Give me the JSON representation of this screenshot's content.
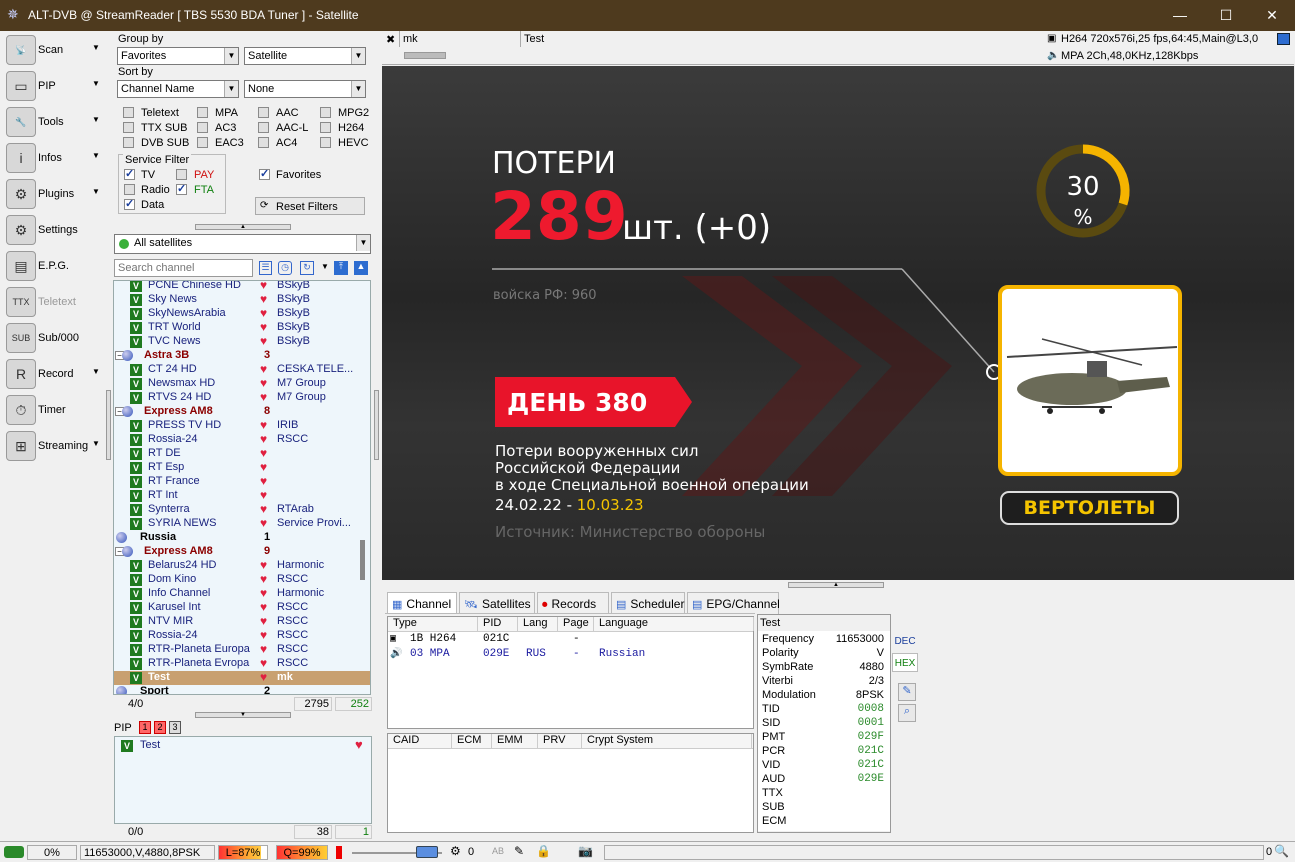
{
  "window": {
    "title": "ALT-DVB @ StreamReader [ TBS 5530 BDA Tuner ] - Satellite",
    "minimize": "—",
    "maximize": "☐",
    "close": "✕"
  },
  "sidebar": {
    "items": [
      {
        "label": "Scan",
        "icon": "satellite-dish-icon",
        "glyph": "📡",
        "arrow": "▼"
      },
      {
        "label": "PIP",
        "icon": "pip-icon",
        "glyph": "▭",
        "arrow": "▼"
      },
      {
        "label": "Tools",
        "icon": "tools-icon",
        "glyph": "🔧",
        "arrow": "▼"
      },
      {
        "label": "Infos",
        "icon": "info-icon",
        "glyph": "i",
        "arrow": "▼"
      },
      {
        "label": "Plugins",
        "icon": "plugins-icon",
        "glyph": "⚙",
        "arrow": "▼"
      },
      {
        "label": "Settings",
        "icon": "settings-icon",
        "glyph": "⚙",
        "arrow": ""
      },
      {
        "label": "E.P.G.",
        "icon": "epg-icon",
        "glyph": "▤",
        "arrow": ""
      },
      {
        "label": "Teletext",
        "icon": "teletext-icon",
        "glyph": "TTX",
        "arrow": ""
      },
      {
        "label": "Sub/000",
        "icon": "subtitle-icon",
        "glyph": "SUB",
        "arrow": ""
      },
      {
        "label": "Record",
        "icon": "record-icon",
        "glyph": "R",
        "arrow": "▼"
      },
      {
        "label": "Timer",
        "icon": "timer-icon",
        "glyph": "⏱",
        "arrow": ""
      },
      {
        "label": "Streaming",
        "icon": "streaming-icon",
        "glyph": "⊞",
        "arrow": "▼"
      }
    ]
  },
  "filters": {
    "group_by_label": "Group by",
    "group_by_1": "Favorites",
    "group_by_2": "Satellite",
    "sort_by_label": "Sort by",
    "sort_by_1": "Channel Name",
    "sort_by_2": "None",
    "stream_checks": [
      "Teletext",
      "MPA",
      "AAC",
      "MPG2",
      "TTX SUB",
      "AC3",
      "AAC-L",
      "H264",
      "DVB SUB",
      "EAC3",
      "AC4",
      "HEVC"
    ],
    "service_filter_label": "Service Filter",
    "tv": "TV",
    "pay": "PAY",
    "radio": "Radio",
    "fta": "FTA",
    "data": "Data",
    "favorites": "Favorites",
    "reset": "Reset Filters",
    "satellite_select": "All satellites",
    "search_placeholder": "Search channel"
  },
  "channels": [
    {
      "type": "ch",
      "name": "PCNE Chinese HD",
      "prov": "BSkyB"
    },
    {
      "type": "ch",
      "name": "Sky News",
      "prov": "BSkyB"
    },
    {
      "type": "ch",
      "name": "SkyNewsArabia",
      "prov": "BSkyB"
    },
    {
      "type": "ch",
      "name": "TRT World",
      "prov": "BSkyB"
    },
    {
      "type": "ch",
      "name": "TVC News",
      "prov": "BSkyB"
    },
    {
      "type": "grp",
      "name": "Astra 3B",
      "count": "3"
    },
    {
      "type": "ch",
      "name": "CT 24 HD",
      "prov": "CESKA TELE..."
    },
    {
      "type": "ch",
      "name": "Newsmax HD",
      "prov": "M7 Group"
    },
    {
      "type": "ch",
      "name": "RTVS 24 HD",
      "prov": "M7 Group"
    },
    {
      "type": "grp",
      "name": "Express AM8",
      "count": "8"
    },
    {
      "type": "ch",
      "name": "PRESS TV HD",
      "prov": "IRIB"
    },
    {
      "type": "ch",
      "name": "Rossia-24",
      "prov": "RSCC"
    },
    {
      "type": "ch",
      "name": "RT DE",
      "prov": ""
    },
    {
      "type": "ch",
      "name": "RT Esp",
      "prov": ""
    },
    {
      "type": "ch",
      "name": "RT France",
      "prov": ""
    },
    {
      "type": "ch",
      "name": "RT Int",
      "prov": ""
    },
    {
      "type": "ch",
      "name": "Synterra",
      "prov": "RTArab"
    },
    {
      "type": "ch",
      "name": "SYRIA NEWS",
      "prov": "Service Provi..."
    },
    {
      "type": "top",
      "name": "Russia",
      "count": "1"
    },
    {
      "type": "grp",
      "name": "Express AM8",
      "count": "9"
    },
    {
      "type": "ch",
      "name": "Belarus24 HD",
      "prov": "Harmonic"
    },
    {
      "type": "ch",
      "name": "Dom Kino",
      "prov": "RSCC"
    },
    {
      "type": "ch",
      "name": "Info Channel",
      "prov": "Harmonic"
    },
    {
      "type": "ch",
      "name": "Karusel Int",
      "prov": "RSCC"
    },
    {
      "type": "ch",
      "name": "NTV MIR",
      "prov": "RSCC"
    },
    {
      "type": "ch",
      "name": "Rossia-24",
      "prov": "RSCC"
    },
    {
      "type": "ch",
      "name": "RTR-Planeta Europa",
      "prov": "RSCC"
    },
    {
      "type": "ch",
      "name": "RTR-Planeta Evropa",
      "prov": "RSCC"
    },
    {
      "type": "sel",
      "name": "Test",
      "prov": "mk"
    },
    {
      "type": "top",
      "name": "Sport",
      "count": "2"
    }
  ],
  "tree_footer": {
    "pos": "4/0",
    "total": "2795",
    "count": "252"
  },
  "pip": {
    "label": "PIP",
    "b1": "1",
    "b2": "2",
    "b3": "3",
    "channel": "Test",
    "footer_pos": "0/0",
    "footer_total": "38",
    "footer_count": "1"
  },
  "topinfo": {
    "name": "mk",
    "channel": "Test",
    "video": "H264 720x576i,25 fps,64:45,Main@L3,0",
    "audio": "MPA 2Ch,48,0KHz,128Kbps"
  },
  "video_overlay": {
    "title": "ПОТЕРИ",
    "big": "289",
    "unit": "шт. (+0)",
    "sub": "войска РФ: 960",
    "percent": "30",
    "percent_sign": "%",
    "day": "ДЕНЬ 380",
    "desc1": "Потери вооруженных сил",
    "desc2": "Российской Федерации",
    "desc3": "в ходе Специальной военной операции",
    "dates_a": "24.02.22 - ",
    "dates_b": "10.03.23",
    "source": "Источник: Министерство обороны",
    "badge": "ВЕРТОЛЕТЫ"
  },
  "tabs": [
    {
      "label": "Channel",
      "icon": "channel-icon"
    },
    {
      "label": "Satellites",
      "icon": "satellite-icon"
    },
    {
      "label": "Records",
      "icon": "record-icon"
    },
    {
      "label": "Scheduler",
      "icon": "scheduler-icon"
    },
    {
      "label": "EPG/Channel",
      "icon": "epg-icon"
    }
  ],
  "streams": {
    "headers": [
      "Type",
      "PID",
      "Lang",
      "Page",
      "Language"
    ],
    "rows": [
      {
        "type": "1B H264",
        "pid": "021C",
        "lang": "",
        "page": "-",
        "language": ""
      },
      {
        "type": "03 MPA",
        "pid": "029E",
        "lang": "RUS",
        "page": "-",
        "language": "Russian"
      }
    ]
  },
  "crypt": {
    "headers": [
      "CAID",
      "ECM",
      "EMM",
      "PRV",
      "Crypt System"
    ]
  },
  "info": {
    "title": "Test",
    "rows": [
      {
        "k": "Frequency",
        "v": "11653000",
        "mono": false
      },
      {
        "k": "Polarity",
        "v": "V",
        "mono": false
      },
      {
        "k": "SymbRate",
        "v": "4880",
        "mono": false
      },
      {
        "k": "Viterbi",
        "v": "2/3",
        "mono": false
      },
      {
        "k": "Modulation",
        "v": "8PSK",
        "mono": false
      },
      {
        "k": "TID",
        "v": "0008",
        "mono": true
      },
      {
        "k": "SID",
        "v": "0001",
        "mono": true
      },
      {
        "k": "PMT",
        "v": "029F",
        "mono": true
      },
      {
        "k": "PCR",
        "v": "021C",
        "mono": true
      },
      {
        "k": "VID",
        "v": "021C",
        "mono": true
      },
      {
        "k": "AUD",
        "v": "029E",
        "mono": true
      },
      {
        "k": "TTX",
        "v": "",
        "mono": false
      },
      {
        "k": "SUB",
        "v": "",
        "mono": false
      },
      {
        "k": "ECM",
        "v": "",
        "mono": false
      }
    ],
    "dec": "DEC",
    "hex": "HEX"
  },
  "status": {
    "pct": "0%",
    "tune": "11653000,V,4880,8PSK",
    "level": "L=87%",
    "quality": "Q=99%",
    "rec_count": "0",
    "ab": "AB",
    "right": "0"
  }
}
